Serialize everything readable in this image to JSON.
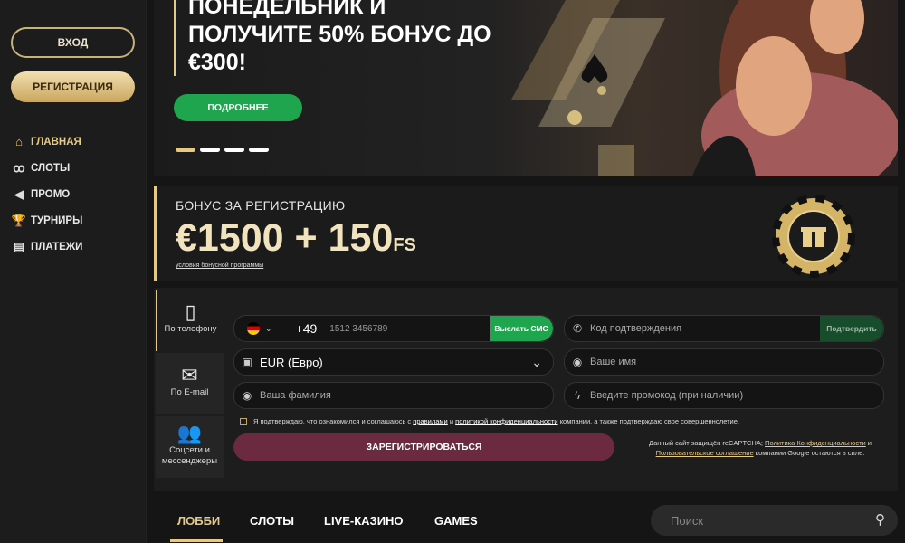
{
  "sidebar": {
    "login_label": "ВХОД",
    "register_label": "РЕГИСТРАЦИЯ",
    "items": [
      {
        "label": "ГЛАВНАЯ",
        "icon": "home-icon",
        "glyph": "⌂"
      },
      {
        "label": "СЛОТЫ",
        "icon": "cherries-icon",
        "glyph": "ꝏ"
      },
      {
        "label": "ПРОМО",
        "icon": "megaphone-icon",
        "glyph": "◀"
      },
      {
        "label": "ТУРНИРЫ",
        "icon": "trophy-icon",
        "glyph": "🏆"
      },
      {
        "label": "ПЛАТЕЖИ",
        "icon": "wallet-icon",
        "glyph": "▤"
      }
    ]
  },
  "hero": {
    "text": "ПОНЕДЕЛЬНИК И ПОЛУЧИТЕ 50% БОНУС ДО €300!",
    "more_label": "ПОДРОБНЕЕ",
    "slides": 4,
    "active_slide": 1
  },
  "bonus": {
    "title": "БОНУС ЗА РЕГИСТРАЦИЮ",
    "amount": "€1500 + 150",
    "amount_suffix": "FS",
    "terms_link": "условия бонусной программы"
  },
  "form": {
    "tabs": [
      {
        "label": "По телефону",
        "icon": "phone-icon",
        "glyph": "▯"
      },
      {
        "label": "По E-mail",
        "icon": "envelope-icon",
        "glyph": "✉"
      },
      {
        "label": "Соцсети и мессенджеры",
        "icon": "people-icon",
        "glyph": "👥"
      }
    ],
    "phone_code": "+49",
    "phone_placeholder": "1512 3456789",
    "sms_button": "Выслать СМС",
    "code_placeholder": "Код подтверждения",
    "verify_button": "Подтвердить",
    "currency_value": "EUR (Евро)",
    "name_placeholder": "Ваше имя",
    "surname_placeholder": "Ваша фамилия",
    "promo_placeholder": "Введите промокод (при наличии)",
    "agree_pre": "Я подтверждаю, что ознакомился и соглашаюсь с",
    "agree_rules": "правилами",
    "agree_and": "и",
    "agree_policy": "политикой конфиденциальности",
    "agree_post": "компании, а также подтверждаю свое совершеннолетие.",
    "submit_label": "ЗАРЕГИСТРИРОВАТЬСЯ",
    "captcha_pre": "Данный сайт защищён reCAPTCHA;",
    "captcha_policy": "Политика Конфиденциальности",
    "captcha_and": "и",
    "captcha_terms": "Пользовательское соглашение",
    "captcha_post": "компании Google остаются в силе."
  },
  "lobby": {
    "tabs": [
      "ЛОББИ",
      "СЛОТЫ",
      "LIVE-КАЗИНО",
      "GAMES"
    ],
    "search_placeholder": "Поиск"
  },
  "colors": {
    "accent_gold": "#e7c983",
    "green": "#1ea54d",
    "submit": "#6b2a3f"
  }
}
